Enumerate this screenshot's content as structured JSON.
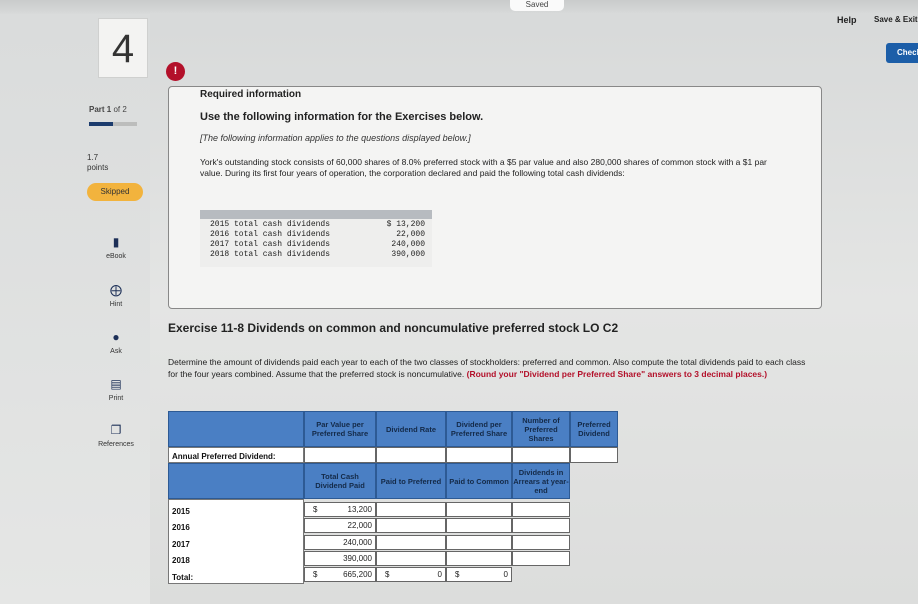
{
  "header": {
    "saved": "Saved",
    "help": "Help",
    "save_exit": "Save & Exit",
    "check": "Check"
  },
  "question": {
    "number": "4",
    "alert": "!"
  },
  "sidebar": {
    "part_label": "Part",
    "part_current": "1",
    "part_of": "of 2",
    "part_progress": 0.5,
    "points_value": "1.7",
    "points_label": "points",
    "status": "Skipped",
    "tools": [
      "eBook",
      "Hint",
      "Ask",
      "Print",
      "References"
    ]
  },
  "info": {
    "required": "Required information",
    "use": "Use the following information for the Exercises below.",
    "applies": "[The following information applies to the questions displayed below.]",
    "paragraph": "York's outstanding stock consists of 60,000 shares of 8.0% preferred stock with a $5 par value and also 280,000 shares of common stock with a $1 par value. During its first four years of operation, the corporation declared and paid the following total cash dividends:",
    "dividends": [
      {
        "label": "2015 total cash dividends",
        "amount": "$ 13,200"
      },
      {
        "label": "2016 total cash dividends",
        "amount": "22,000"
      },
      {
        "label": "2017 total cash dividends",
        "amount": "240,000"
      },
      {
        "label": "2018 total cash dividends",
        "amount": "390,000"
      }
    ]
  },
  "exercise": {
    "title": "Exercise 11-8 Dividends on common and noncumulative preferred stock LO C2",
    "instructions": "Determine the amount of dividends paid each year to each of the two classes of stockholders: preferred and common. Also compute the total dividends paid to each class for the four years combined. Assume that the preferred stock is noncumulative.",
    "instructions_red": "(Round your \"Dividend per Preferred Share\" answers to 3 decimal places.)"
  },
  "table": {
    "header1": [
      "Par Value per Preferred Share",
      "Dividend Rate",
      "Dividend per Preferred Share",
      "Number of Preferred Shares",
      "Preferred Dividend"
    ],
    "annual_label": "Annual Preferred Dividend:",
    "header2": [
      "Total Cash Dividend Paid",
      "Paid to Preferred",
      "Paid to Common",
      "Dividends in Arrears at year-end"
    ],
    "rows": [
      {
        "year": "2015",
        "total": "13,200"
      },
      {
        "year": "2016",
        "total": "22,000"
      },
      {
        "year": "2017",
        "total": "240,000"
      },
      {
        "year": "2018",
        "total": "390,000"
      }
    ],
    "total_label": "Total:",
    "total_sum": "665,200",
    "total_preferred": "0",
    "total_common": "0",
    "currency": "$"
  }
}
